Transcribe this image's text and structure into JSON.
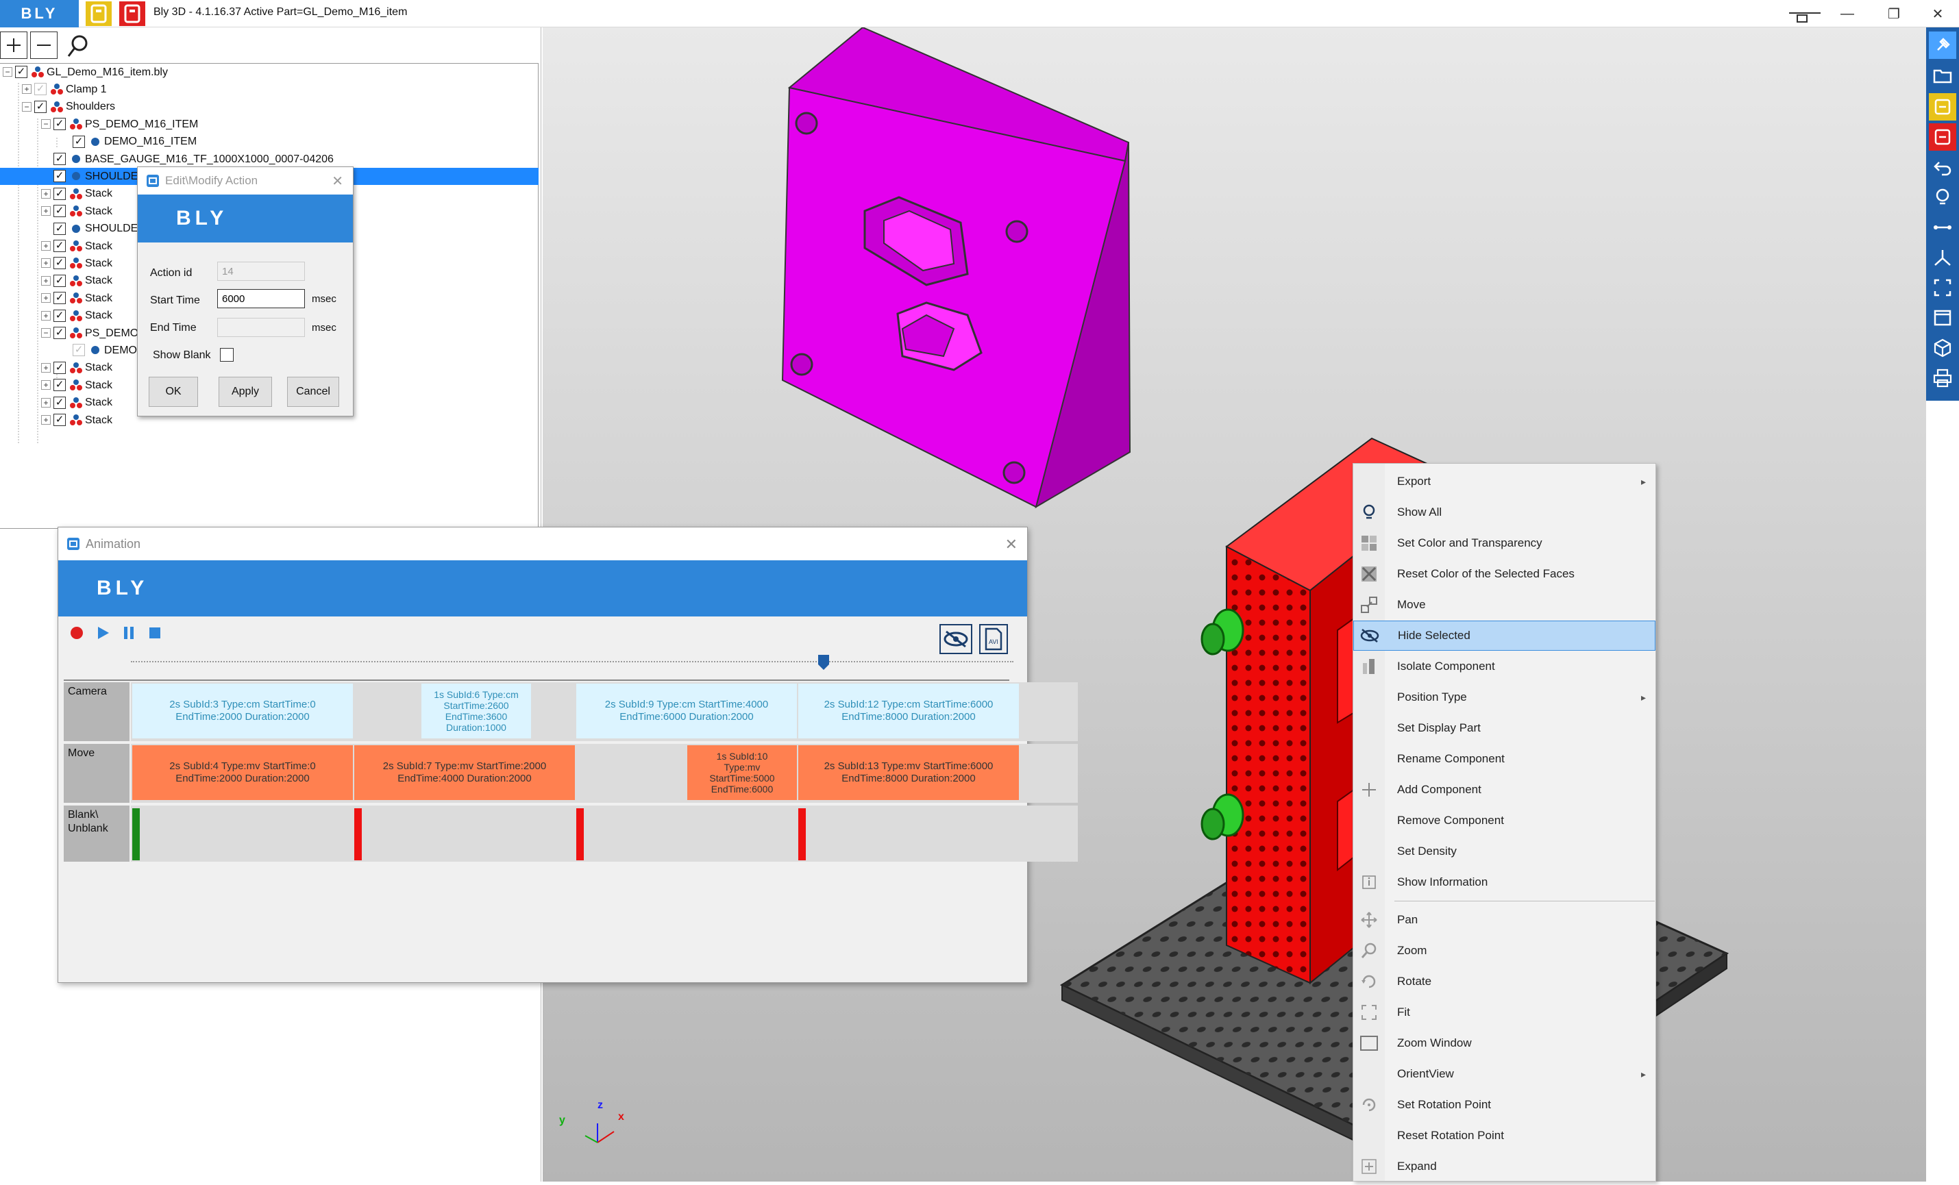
{
  "app": {
    "logo": "BLY",
    "title": "Bly 3D - 4.1.16.37 Active Part=GL_Demo_M16_item"
  },
  "tree": {
    "items": [
      {
        "label": "GL_Demo_M16_item.bly"
      },
      {
        "label": "Clamp 1"
      },
      {
        "label": "Shoulders"
      },
      {
        "label": "PS_DEMO_M16_ITEM"
      },
      {
        "label": "DEMO_M16_ITEM"
      },
      {
        "label": "BASE_GAUGE_M16_TF_1000X1000_0007-04206"
      },
      {
        "label": "SHOULDE"
      },
      {
        "label": "Stack"
      },
      {
        "label": "Stack"
      },
      {
        "label": "SHOULDE"
      },
      {
        "label": "Stack"
      },
      {
        "label": "Stack"
      },
      {
        "label": "Stack"
      },
      {
        "label": "Stack"
      },
      {
        "label": "Stack"
      },
      {
        "label": "PS_DEMO"
      },
      {
        "label": "DEMO"
      },
      {
        "label": "Stack"
      },
      {
        "label": "Stack"
      },
      {
        "label": "Stack"
      },
      {
        "label": "Stack"
      }
    ]
  },
  "edit_dialog": {
    "title": "Edit\\Modify Action",
    "logo": "BLY",
    "action_id_label": "Action id",
    "action_id_value": "14",
    "start_time_label": "Start Time",
    "start_time_value": "6000",
    "start_unit": "msec",
    "end_time_label": "End Time",
    "end_time_value": "",
    "end_unit": "msec",
    "show_blank_label": "Show Blank",
    "show_blank_checked": false,
    "ok": "OK",
    "apply": "Apply",
    "cancel": "Cancel"
  },
  "animation": {
    "title": "Animation",
    "logo": "BLY",
    "tracks": {
      "camera": "Camera",
      "move": "Move",
      "blank": "Blank\\\nUnblank"
    },
    "camera_blocks": [
      "2s SubId:3 Type:cm StartTime:0\nEndTime:2000 Duration:2000",
      "1s SubId:6 Type:cm\nStartTime:2600\nEndTime:3600\nDuration:1000",
      "2s SubId:9 Type:cm StartTime:4000\nEndTime:6000 Duration:2000",
      "2s SubId:12 Type:cm StartTime:6000\nEndTime:8000 Duration:2000"
    ],
    "move_blocks": [
      "2s SubId:4 Type:mv StartTime:0\nEndTime:2000 Duration:2000",
      "2s SubId:7 Type:mv StartTime:2000\nEndTime:4000 Duration:2000",
      "1s SubId:10\nType:mv\nStartTime:5000\nEndTime:6000",
      "2s SubId:13 Type:mv StartTime:6000\nEndTime:8000 Duration:2000"
    ],
    "colors": {
      "camera": "#dcf4ff",
      "move": "#ff8050",
      "blank_first": "#1a8a1a",
      "blank_other": "#ee1111"
    }
  },
  "context_menu": {
    "items": [
      {
        "label": "Export",
        "icon": "export-icon",
        "submenu": true
      },
      {
        "label": "Show All",
        "icon": "lightbulb-icon"
      },
      {
        "label": "Set Color and Transparency",
        "icon": "color-grid-icon"
      },
      {
        "label": "Reset Color of the Selected Faces",
        "icon": "reset-color-icon"
      },
      {
        "label": "Move",
        "icon": "move-icon"
      },
      {
        "label": "Hide Selected",
        "icon": "eye-hidden-icon",
        "highlighted": true
      },
      {
        "label": "Isolate Component",
        "icon": "isolate-icon"
      },
      {
        "label": "Position Type",
        "icon": "none",
        "submenu": true
      },
      {
        "label": "Set Display Part",
        "icon": "none"
      },
      {
        "label": "Rename Component",
        "icon": "none"
      },
      {
        "label": "Add Component",
        "icon": "plus-icon"
      },
      {
        "label": "Remove Component",
        "icon": "none"
      },
      {
        "label": "Set Density",
        "icon": "none"
      },
      {
        "label": "Show Information",
        "icon": "info-icon"
      },
      {
        "label": "Pan",
        "icon": "pan-icon"
      },
      {
        "label": "Zoom",
        "icon": "zoom-icon"
      },
      {
        "label": "Rotate",
        "icon": "rotate-icon"
      },
      {
        "label": "Fit",
        "icon": "fit-icon"
      },
      {
        "label": "Zoom Window",
        "icon": "zoom-window-icon"
      },
      {
        "label": "OrientView",
        "icon": "none",
        "submenu": true
      },
      {
        "label": "Set Rotation Point",
        "icon": "rotation-point-icon"
      },
      {
        "label": "Reset Rotation Point",
        "icon": "none"
      },
      {
        "label": "Expand",
        "icon": "expand-icon"
      }
    ],
    "arrow": "▸"
  },
  "axis_triad": {
    "x": "x",
    "y": "y",
    "z": "z"
  },
  "colors": {
    "accent": "#2f86d9",
    "part_magenta": "#e400ee",
    "fixture_red": "#ee0a0a",
    "clamp_green": "#2ecc2e",
    "base_gray": "#5a5a5a"
  }
}
